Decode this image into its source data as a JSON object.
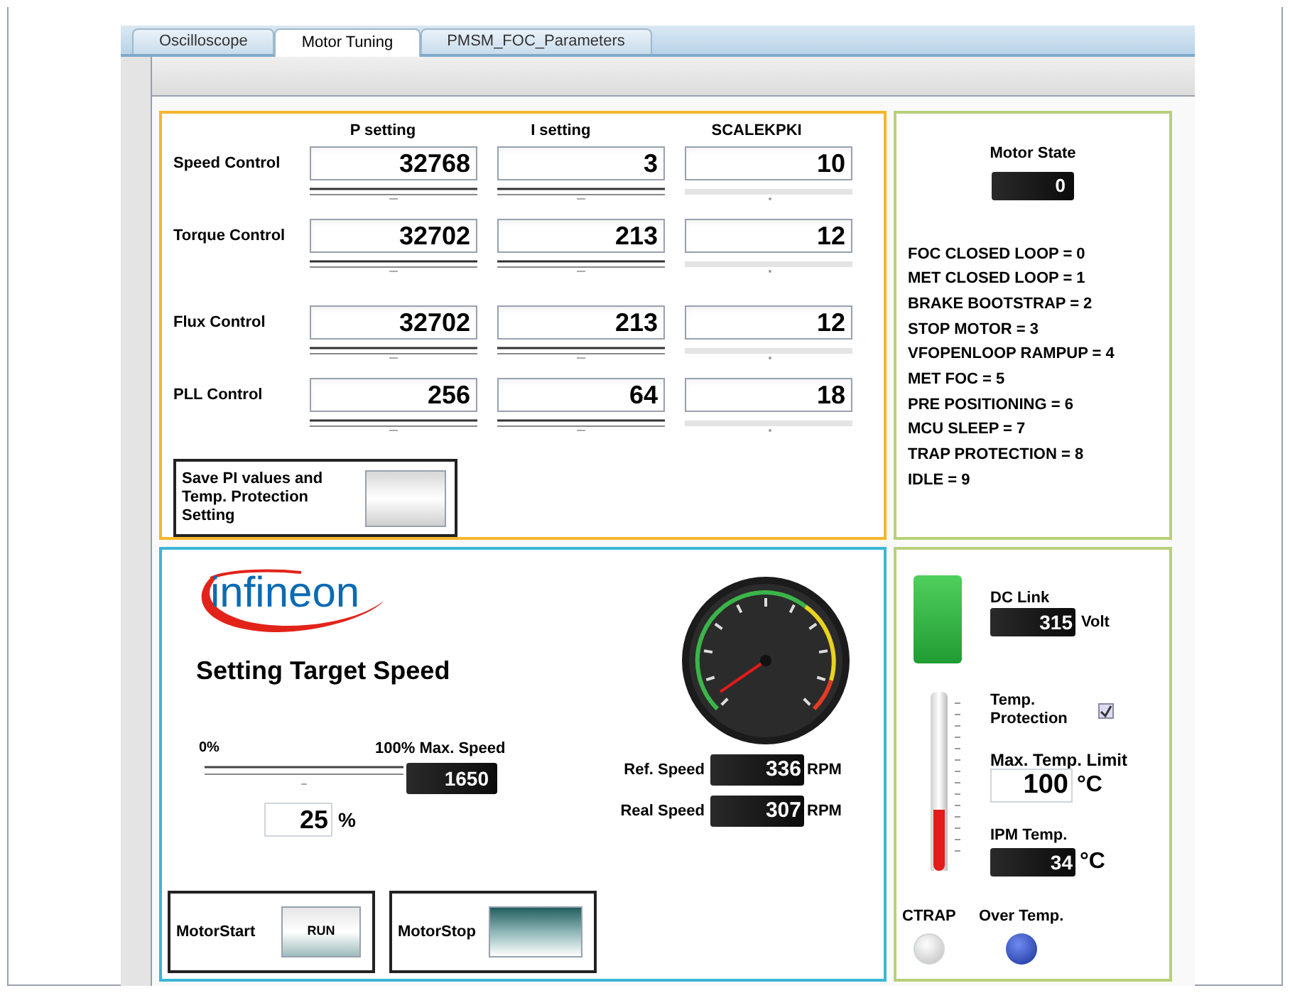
{
  "tabs": [
    {
      "label": "Oscilloscope",
      "selected": false
    },
    {
      "label": "Motor Tuning",
      "selected": true
    },
    {
      "label": "PMSM_FOC_Parameters",
      "selected": false
    }
  ],
  "pi_table": {
    "columns": [
      "P setting",
      "I setting",
      "SCALEKPKI"
    ],
    "rows": [
      {
        "label": "Speed Control",
        "values": [
          "32768",
          "3",
          "10"
        ]
      },
      {
        "label": "Torque Control",
        "values": [
          "32702",
          "213",
          "12"
        ]
      },
      {
        "label": "Flux Control",
        "values": [
          "32702",
          "213",
          "12"
        ]
      },
      {
        "label": "PLL Control",
        "values": [
          "256",
          "64",
          "18"
        ]
      }
    ]
  },
  "save_button": {
    "label": "Save PI values and Temp. Protection Setting"
  },
  "motor_state": {
    "label": "Motor State",
    "value": "0",
    "states": [
      "FOC CLOSED LOOP = 0",
      "MET CLOSED LOOP = 1",
      "BRAKE BOOTSTRAP = 2",
      "STOP MOTOR = 3",
      "VFOPENLOOP RAMPUP = 4",
      "MET FOC = 5",
      "PRE POSITIONING = 6",
      "MCU SLEEP = 7",
      "TRAP PROTECTION = 8",
      "IDLE = 9"
    ]
  },
  "logo_text": "infineon",
  "target_speed": {
    "title": "Setting Target Speed",
    "min_label": "0%",
    "max_label": "100% Max. Speed",
    "max_value": "1650",
    "percent": "25",
    "percent_unit": "%"
  },
  "speeds": [
    {
      "label": "Ref. Speed",
      "value": "336",
      "unit": "RPM"
    },
    {
      "label": "Real Speed",
      "value": "307",
      "unit": "RPM"
    }
  ],
  "motor_buttons": [
    {
      "label": "MotorStart",
      "button_label": "RUN"
    },
    {
      "label": "MotorStop"
    }
  ],
  "dc_link": {
    "label": "DC Link",
    "value": "315",
    "unit": "Volt",
    "lamp_on": true
  },
  "temp_protection": {
    "label": "Temp. Protection",
    "checked": true
  },
  "max_temp": {
    "label": "Max. Temp. Limit",
    "value": "100",
    "unit": "°C"
  },
  "ipm_temp": {
    "label": "IPM Temp.",
    "value": "34",
    "unit": "°C",
    "level": 0.34
  },
  "indicators": [
    {
      "label": "CTRAP",
      "on": false
    },
    {
      "label": "Over Temp.",
      "on": true
    }
  ]
}
